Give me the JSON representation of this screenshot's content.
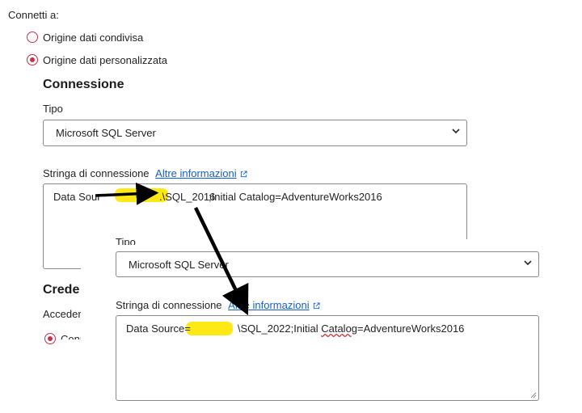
{
  "back": {
    "connect_to": "Connetti a:",
    "radio_shared": "Origine dati condivisa",
    "radio_custom": "Origine dati personalizzata",
    "section_connection": "Connessione",
    "type_label": "Tipo",
    "type_value": "Microsoft SQL Server",
    "conn_label": "Stringa di connessione",
    "conn_link": "Altre informazioni",
    "conn_text_a": "Data Sour",
    "conn_text_b": ".\\SQL_2016",
    "conn_text_c": ";Initial Catalog=AdventureWorks2016",
    "cred_heading": "Crede",
    "access_label": "Acceder",
    "partial_radio": "Conn"
  },
  "front": {
    "type_label": "Tipo",
    "type_value": "Microsoft SQL Server",
    "conn_label": "Stringa di connessione",
    "conn_link": "Altre informazioni",
    "conn_text_a": "Data Source=",
    "conn_text_b": "\\SQL_2022;Initial ",
    "conn_text_c": "Catalog",
    "conn_text_d": "=AdventureWorks2016"
  },
  "colors": {
    "accent_radio": "#c4314b",
    "link": "#1560c8",
    "highlight": "#ffe600"
  }
}
